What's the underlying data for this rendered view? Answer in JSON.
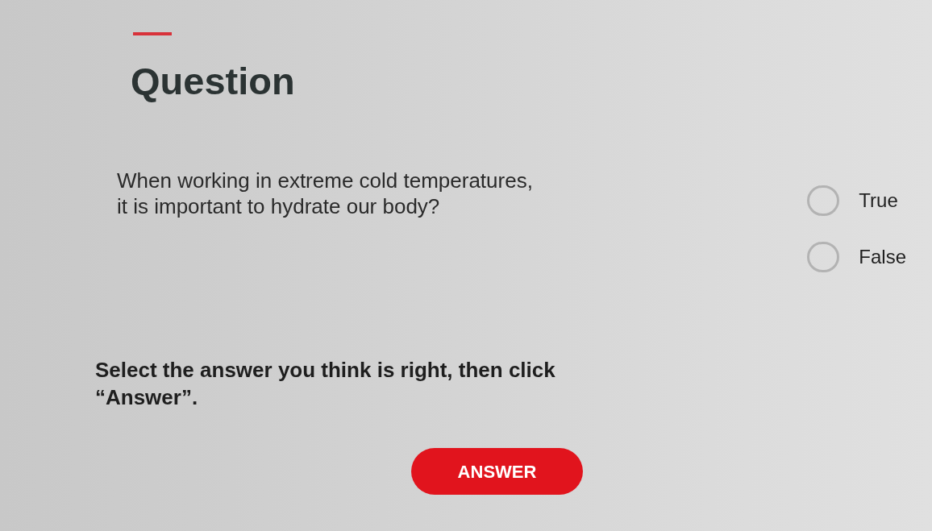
{
  "question_panel": {
    "title": "Question",
    "prompt": [
      "When working in extreme cold temperatures,",
      "it is important to hydrate our body?"
    ],
    "options": [
      {
        "label": "True",
        "selected": false
      },
      {
        "label": "False",
        "selected": false
      }
    ],
    "instruction": [
      "Select the answer you think is right, then click",
      "“Answer”."
    ],
    "button": "ANSWER"
  }
}
